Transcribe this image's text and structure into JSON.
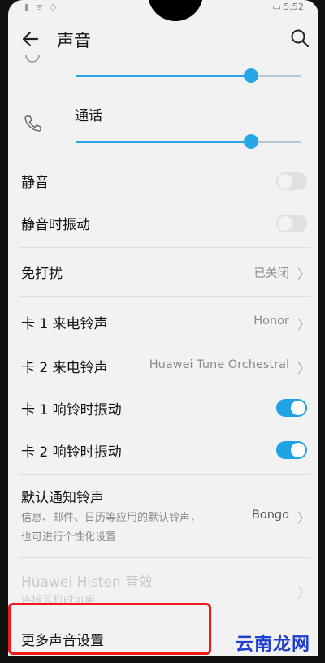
{
  "status": {
    "time": "5:52"
  },
  "header": {
    "title": "声音"
  },
  "volume": {
    "media_level": 0.78,
    "call_label": "通话",
    "call_level": 0.78
  },
  "settings": {
    "mute": {
      "label": "静音",
      "on": false
    },
    "vibrate_silent": {
      "label": "静音时振动",
      "on": false
    },
    "dnd": {
      "label": "免打扰",
      "value": "已关闭"
    },
    "card1_ringtone": {
      "label": "卡 1 来电铃声",
      "value": "Honor"
    },
    "card2_ringtone": {
      "label": "卡 2 来电铃声",
      "value": "Huawei Tune Orchestral"
    },
    "card1_vibrate": {
      "label": "卡 1 响铃时振动",
      "on": true
    },
    "card2_vibrate": {
      "label": "卡 2 响铃时振动",
      "on": true
    },
    "notify_ringtone": {
      "label": "默认通知铃声",
      "desc1": "信息、邮件、日历等应用的默认铃声，",
      "desc2": "也可进行个性化设置",
      "value": "Bongo"
    },
    "histen": {
      "label": "Huawei Histen 音效",
      "desc": "连接耳机时可用"
    },
    "more": {
      "label": "更多声音设置"
    }
  },
  "watermark": "云南龙网",
  "colors": {
    "accent": "#28a7e8",
    "highlight": "#ec1c1c",
    "watermark": "#1f3fd1"
  }
}
